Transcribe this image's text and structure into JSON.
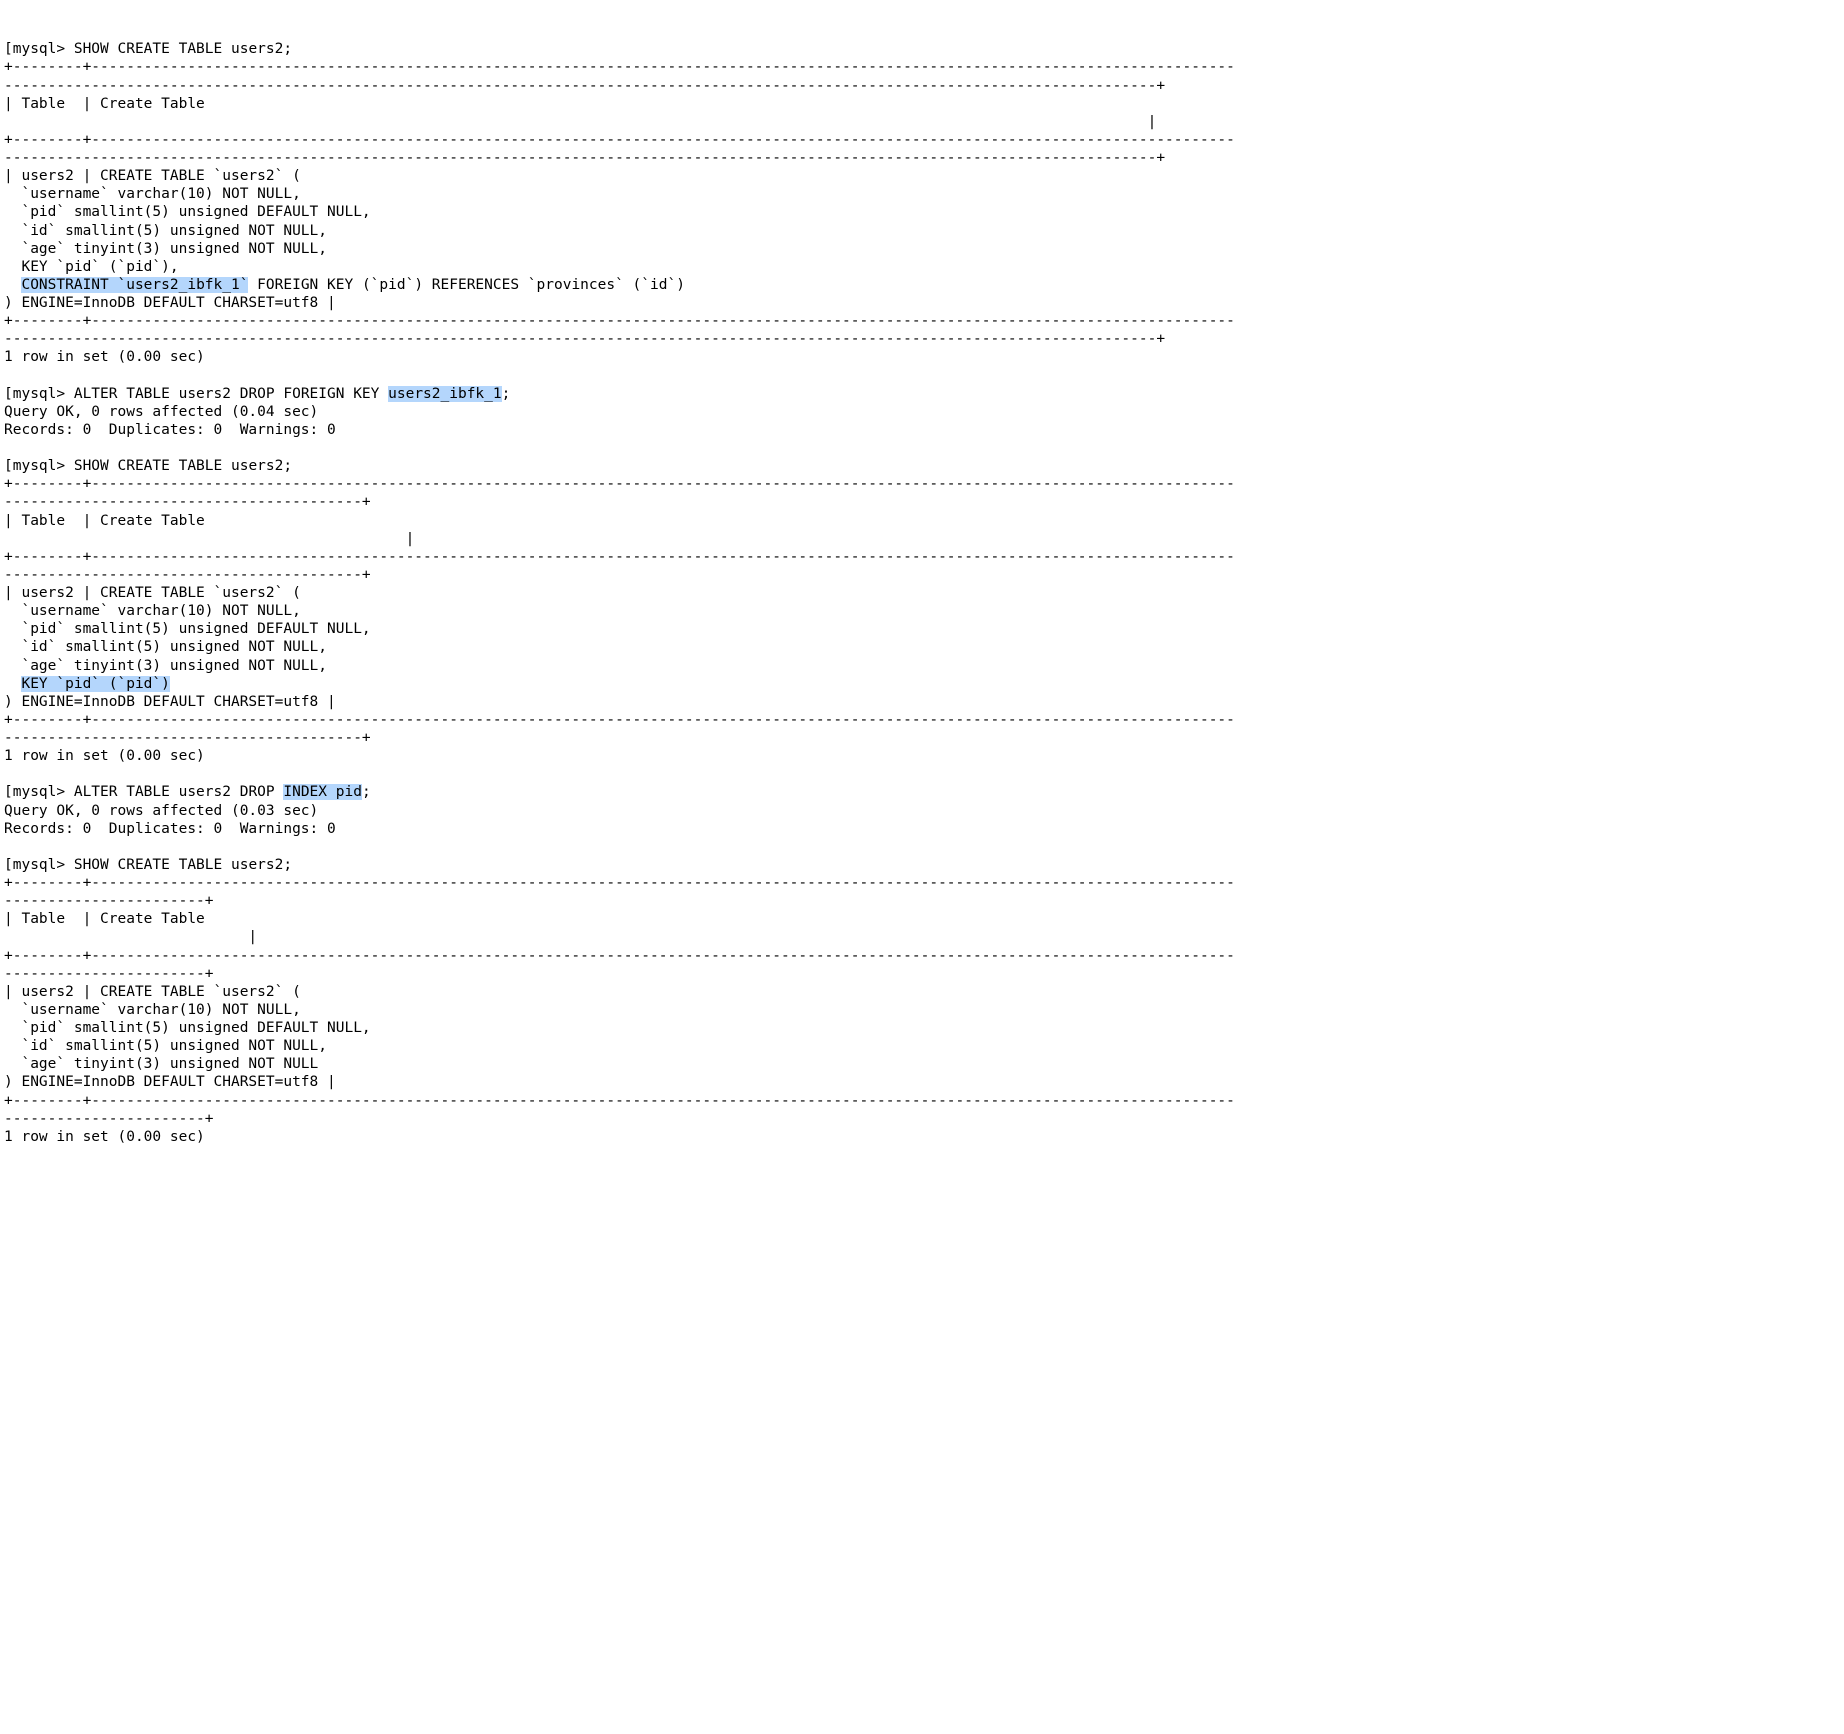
{
  "prompt": "mysql> ",
  "bracket": "[",
  "cmd": {
    "show1": "SHOW CREATE TABLE users2;",
    "alter1_pre": "ALTER TABLE users2 DROP FOREIGN KEY ",
    "alter1_hl": "users2_ibfk_1",
    "alter1_post": ";",
    "show2": "SHOW CREATE TABLE users2;",
    "alter2_pre": "ALTER TABLE users2 DROP ",
    "alter2_hl": "INDEX pid",
    "alter2_post": ";",
    "show3": "SHOW CREATE TABLE users2;"
  },
  "sep": {
    "long_a": "+--------+-----------------------------------------------------------------------------------------------------------------------------------",
    "long_b": "------------------------------------------------------------------------------------------------------------------------------------+",
    "hdr_a": "| Table  | Create Table",
    "hdr_b": "                                                                                                                                   |",
    "mid_a": "-----------------------------------------+",
    "hdr2_b": "                                              |",
    "short_a": "-----------------------+",
    "hdr3_b": "                            |"
  },
  "block1": {
    "l0": "| users2 | CREATE TABLE `users2` (",
    "l1": "  `username` varchar(10) NOT NULL,",
    "l2": "  `pid` smallint(5) unsigned DEFAULT NULL,",
    "l3": "  `id` smallint(5) unsigned NOT NULL,",
    "l4": "  `age` tinyint(3) unsigned NOT NULL,",
    "l5": "  KEY `pid` (`pid`),",
    "l6_pre": "  ",
    "l6_hl": "CONSTRAINT `users2_ibfk_1`",
    "l6_post": " FOREIGN KEY (`pid`) REFERENCES `provinces` (`id`)",
    "l7": ") ENGINE=InnoDB DEFAULT CHARSET=utf8 |"
  },
  "block2": {
    "l0": "| users2 | CREATE TABLE `users2` (",
    "l1": "  `username` varchar(10) NOT NULL,",
    "l2": "  `pid` smallint(5) unsigned DEFAULT NULL,",
    "l3": "  `id` smallint(5) unsigned NOT NULL,",
    "l4": "  `age` tinyint(3) unsigned NOT NULL,",
    "l5_pre": "  ",
    "l5_hl": "KEY `pid` (`pid`)",
    "l6": ") ENGINE=InnoDB DEFAULT CHARSET=utf8 |"
  },
  "block3": {
    "l0": "| users2 | CREATE TABLE `users2` (",
    "l1": "  `username` varchar(10) NOT NULL,",
    "l2": "  `pid` smallint(5) unsigned DEFAULT NULL,",
    "l3": "  `id` smallint(5) unsigned NOT NULL,",
    "l4": "  `age` tinyint(3) unsigned NOT NULL",
    "l5": ") ENGINE=InnoDB DEFAULT CHARSET=utf8 |"
  },
  "result": {
    "row_000": "1 row in set (0.00 sec)",
    "ok_004": "Query OK, 0 rows affected (0.04 sec)",
    "ok_003": "Query OK, 0 rows affected (0.03 sec)",
    "records": "Records: 0  Duplicates: 0  Warnings: 0"
  }
}
